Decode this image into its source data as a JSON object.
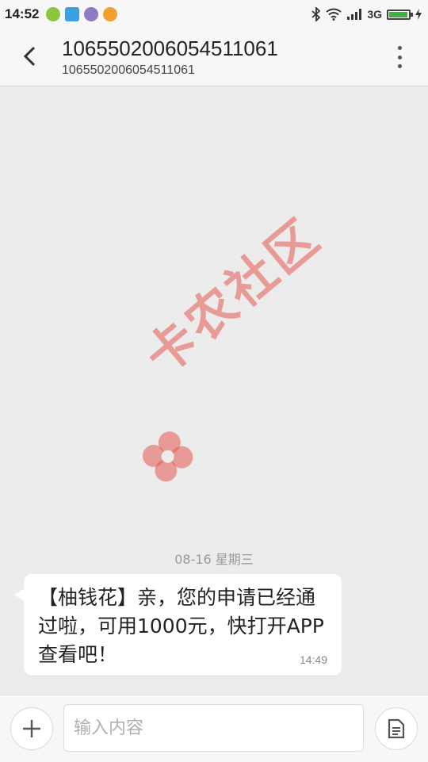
{
  "status_bar": {
    "time": "14:52",
    "network": "3G",
    "battery_level": 0.9,
    "icons": [
      "app-icon-green",
      "app-icon-blue",
      "app-icon-purple",
      "app-icon-orange",
      "bluetooth-icon",
      "wifi-icon",
      "signal-icon",
      "battery-icon"
    ]
  },
  "header": {
    "title": "1065502006054511061",
    "subtitle": "1065502006054511061"
  },
  "conversation": {
    "date_divider": "08-16  星期三",
    "messages": [
      {
        "text": "【柚钱花】亲，您的申请已经通过啦，可用1000元，快打开APP查看吧！",
        "time": "14:49",
        "direction": "incoming"
      }
    ]
  },
  "watermark": {
    "text": "卡农社区",
    "color": "#e65a50"
  },
  "composer": {
    "placeholder": "输入内容"
  },
  "colors": {
    "background": "#ececec",
    "bar": "#f7f7f7",
    "bubble": "#ffffff"
  }
}
